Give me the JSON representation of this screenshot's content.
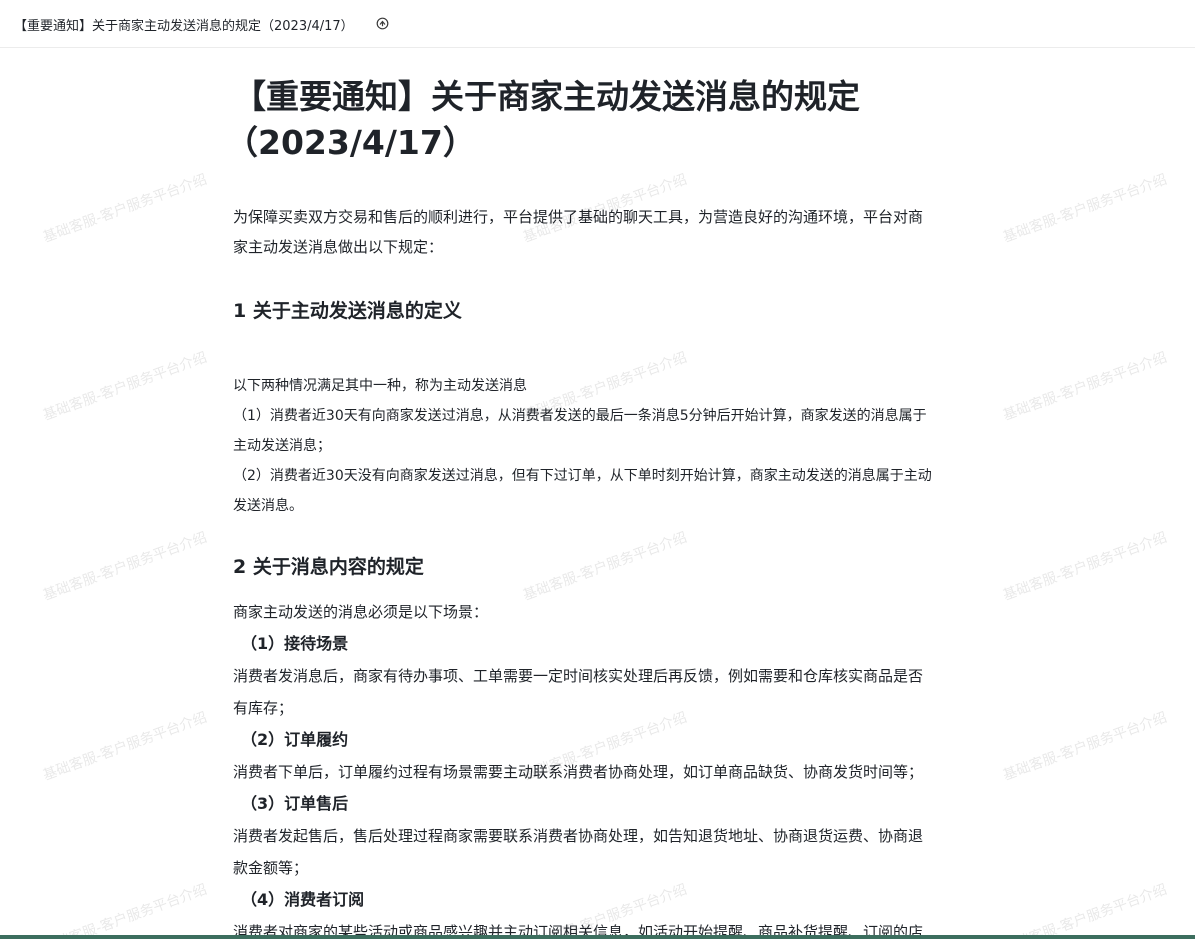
{
  "header": {
    "tab_title": "【重要通知】关于商家主动发送消息的规定（2023/4/17）",
    "icon": "share-icon"
  },
  "watermark": {
    "text": "基础客服-客户服务平台介绍"
  },
  "doc": {
    "title_line1": "【重要通知】关于商家主动发送消息的规定",
    "title_line2": "（2023/4/17）",
    "intro_line1": "为保障买卖双方交易和售后的顺利进行，平台提供了基础的聊天工具，为营造良好的沟通环境，平台对商",
    "intro_line2": "家主动发送消息做出以下规定：",
    "section1_heading": "1 关于主动发送消息的定义",
    "s1_p1": "以下两种情况满足其中一种，称为主动发送消息",
    "s1_p2_line1": "（1）消费者近30天有向商家发送过消息，从消费者发送的最后一条消息5分钟后开始计算，商家发送的消息属于",
    "s1_p2_line2": "主动发送消息；",
    "s1_p3_line1": "（2）消费者近30天没有向商家发送过消息，但有下过订单，从下单时刻开始计算，商家主动发送的消息属于主动",
    "s1_p3_line2": "发送消息。",
    "section2_heading": "2 关于消息内容的规定",
    "s2_intro": "商家主动发送的消息必须是以下场景：",
    "s2_h1": "（1）接待场景",
    "s2_h1_line1": "消费者发消息后，商家有待办事项、工单需要一定时间核实处理后再反馈，例如需要和仓库核实商品是否",
    "s2_h1_line2": "有库存；",
    "s2_h2": "（2）订单履约",
    "s2_h2_line1": "消费者下单后，订单履约过程有场景需要主动联系消费者协商处理，如订单商品缺货、协商发货时间等；",
    "s2_h3": "（3）订单售后",
    "s2_h3_line1": "消费者发起售后，售后处理过程商家需要联系消费者协商处理，如告知退货地址、协商退货运费、协商退",
    "s2_h3_line2": "款金额等；",
    "s2_h4": "（4）消费者订阅",
    "s2_h4_line1": "消费者对商家的某些活动或商品感兴趣并主动订阅相关信息，如活动开始提醒、商品补货提醒、订阅的店"
  }
}
